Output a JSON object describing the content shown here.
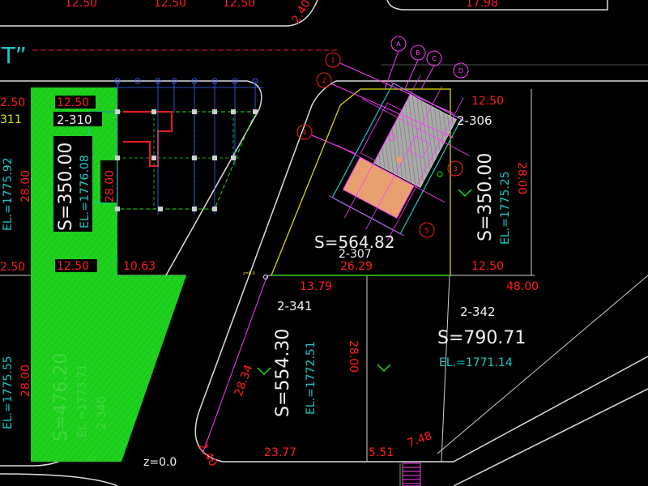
{
  "colors": {
    "background": "#000000",
    "road_line": "#dcdcdc",
    "dimension_red": "#ff1e1e",
    "lot_label_white": "#f0f0f0",
    "elevation_cyan": "#19c8c8",
    "green_fill": "#1ed21e",
    "yellow_line": "#e6e600",
    "magenta": "#ff3cff",
    "grid_blue": "#3c64ff",
    "grid_green": "#1edc1e"
  },
  "top_dims": {
    "d1": "12.50",
    "d2": "12.50",
    "d3": "12.50",
    "d4": "17.98",
    "road_angle": "2.40"
  },
  "title_fragment": "T”",
  "left_lots": {
    "dim_top_left": "2.50",
    "dim_mid_left": "2.50",
    "code_partial": "311",
    "el_partial": "EL.=1775.92",
    "dim_28_left": "28.00",
    "dim_28_lower": "28.00",
    "el_lower_partial": "EL.=1775.55"
  },
  "lot_2310": {
    "code": "2-310",
    "area": "S=350.00",
    "el": "EL.=1776.08",
    "dim_top": "12.50",
    "dim_bottom": "12.50",
    "dim_side": "28.00",
    "dim_1063": "10.63"
  },
  "lot_2340": {
    "area": "S=476.20",
    "el": "EL.=1773.71",
    "code": "2-340"
  },
  "lot_2306": {
    "code": "2-306",
    "area": "S=350.00",
    "el": "EL.=1775.25",
    "dim_top": "12.50",
    "dim_bottom": "12.50",
    "dim_side": "28.00"
  },
  "lot_2307": {
    "area": "S=564.82",
    "code": "2-307",
    "dim_bottom": "26.29",
    "dim_1379": "13.79"
  },
  "lot_2341": {
    "code": "2-341",
    "area": "S=554.30",
    "el": "EL.=1772.51",
    "dim_side": "28.34",
    "dim_bottom": "23.77",
    "dim_vert": "28.00"
  },
  "lot_2342": {
    "code": "2-342",
    "area": "S=790.71",
    "el": "EL.=1771.14",
    "dim_top": "48.00",
    "dim_551": "5.51",
    "dim_748": "7.48"
  },
  "misc": {
    "z_label": "z=0.0",
    "angle_bottom": "2.40",
    "small_z": "z=0.0"
  },
  "grid_axes_top": [
    "A",
    "B",
    "C",
    "D"
  ],
  "grid_axes_left": [
    "1",
    "2",
    "3",
    "4",
    "5"
  ]
}
